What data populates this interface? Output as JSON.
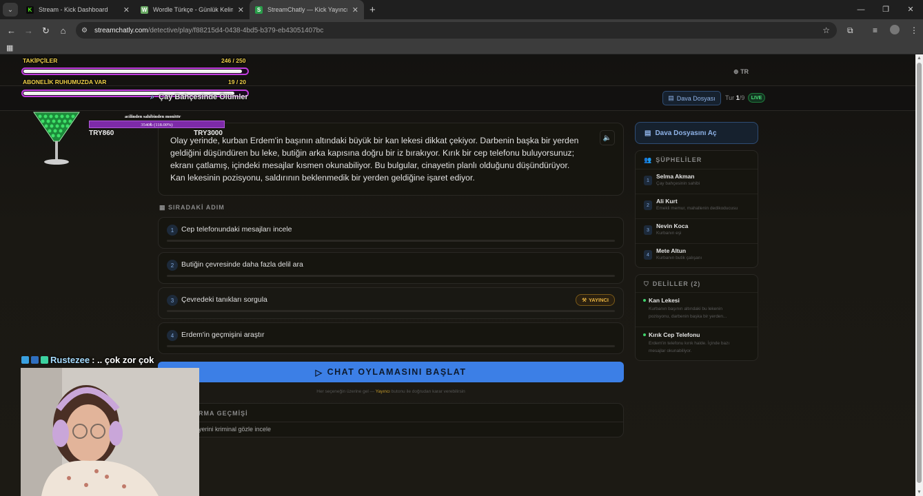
{
  "browser": {
    "tabs": [
      {
        "title": "Stream - Kick Dashboard",
        "favicon": "K",
        "color": "#53fc18",
        "active": false
      },
      {
        "title": "Wordle Türkçe - Günlük Kelime",
        "favicon": "W",
        "color": "#6aaa64",
        "active": false
      },
      {
        "title": "StreamChatly — Kick Yayıncıları",
        "favicon": "S",
        "color": "#2a9d4a",
        "active": true
      }
    ],
    "url_host": "streamchatly.com",
    "url_path": "/detective/play/f88215d4-0438-4bd5-b379-eb43051407bc"
  },
  "header": {
    "lang": "TR"
  },
  "toolbar": {
    "case_file_label": "Dava Dosyası",
    "round_prefix": "Tur",
    "round_current": "1",
    "round_total": "/9",
    "live_label": "LIVE"
  },
  "story": {
    "text": "Olay yerinde, kurban Erdem'in başının altındaki büyük bir kan lekesi dikkat çekiyor. Darbenin başka bir yerden geldiğini düşündüren bu leke, butiğin arka kapısına doğru bir iz bırakıyor. Kırık bir cep telefonu buluyorsunuz; ekranı çatlamış, içindeki mesajlar kısmen okunabiliyor. Bu bulgular, cinayetin planlı olduğunu düşündürüyor. Kan lekesinin pozisyonu, saldırının beklenmedik bir yerden geldiğine işaret ediyor."
  },
  "next_step": {
    "label": "SIRADAKİ ADIM",
    "steps": [
      {
        "num": "1",
        "text": "Cep telefonundaki mesajları incele"
      },
      {
        "num": "2",
        "text": "Butiğin çevresinde daha fazla delil ara"
      },
      {
        "num": "3",
        "text": "Çevredeki tanıkları sorgula",
        "badge": "YAYINCI"
      },
      {
        "num": "4",
        "text": "Erdem'in geçmişini araştır"
      }
    ]
  },
  "vote": {
    "button_label": "CHAT OYLAMASINI BAŞLAT",
    "hint_before": "Her seçeneğin üzerine gel —",
    "hint_highlight": "Yayıncı",
    "hint_after": "butonu ile doğrudan karar verebilirsin"
  },
  "history": {
    "label": "RMA GEÇMİŞİ",
    "item": "yerini kriminal gözle incele"
  },
  "sidebar": {
    "open_case_label": "Dava Dosyasını Aç",
    "suspects_label": "ŞÜPHELİLER",
    "suspects": [
      {
        "num": "1",
        "name": "Selma Akman",
        "desc": "Çay bahçesinin sahibi"
      },
      {
        "num": "2",
        "name": "Ali Kurt",
        "desc": "Emekli memur, mahallenin dedikoducusu"
      },
      {
        "num": "3",
        "name": "Nevin Koca",
        "desc": "Kurbanın eşi"
      },
      {
        "num": "4",
        "name": "Mete Altun",
        "desc": "Kurbanın butik çalışanı"
      }
    ],
    "evidence_label": "DELİLLER (2)",
    "evidence": [
      {
        "name": "Kan Lekesi",
        "desc": "Kurbanın başının altındaki bu lekenin pozisyonu, darbenin başka bir yerden..."
      },
      {
        "name": "Kırık Cep Telefonu",
        "desc": "Erdem'in telefonu kırık halde. İçinde bazı mesajlar okunabiliyor."
      }
    ]
  },
  "overlay": {
    "followers_label": "TAKİPÇİLER",
    "followers_count": "246 / 250",
    "followers_progress": 0.984,
    "subs_label": "ABONELİK RUHUMUZDA VAR",
    "subs_count": "19 / 20",
    "subs_progress": 0.95,
    "category_title": "Çay Bahçesinde Ölümler",
    "monitor_title": "acilinden sahibinden monitör",
    "monitor_progress_text": "3540₺ (118.00%)",
    "monitor_current": "TRY860",
    "monitor_goal": "TRY3000",
    "chat_user": "Rustezee",
    "chat_message": ": .. çok zor çok"
  }
}
